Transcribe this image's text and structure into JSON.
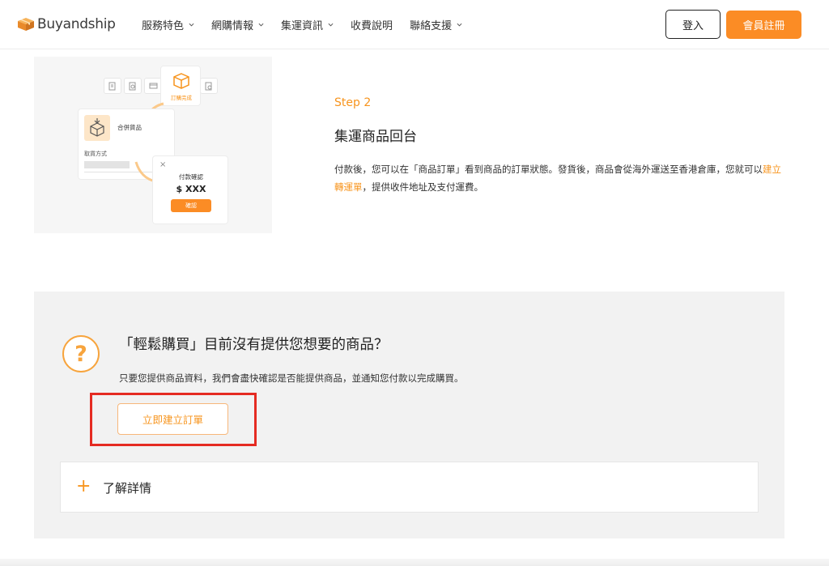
{
  "header": {
    "logo_text": "Buyandship",
    "nav": [
      {
        "label": "服務特色",
        "has_dropdown": true
      },
      {
        "label": "網購情報",
        "has_dropdown": true
      },
      {
        "label": "集運資訊",
        "has_dropdown": true
      },
      {
        "label": "收費說明",
        "has_dropdown": false
      },
      {
        "label": "聯絡支援",
        "has_dropdown": true
      }
    ],
    "login_label": "登入",
    "register_label": "會員註冊"
  },
  "illustration": {
    "order_complete": "訂購完成",
    "merge_goods": "合併貨品",
    "pickup_method": "取貨方式",
    "payment_confirm": "付款確認",
    "amount": "$ XXX",
    "confirm_button": "確認",
    "close_symbol": "×"
  },
  "step": {
    "label": "Step 2",
    "title": "集運商品回台",
    "desc_part1": "付款後，您可以在「商品訂單」看到商品的訂單狀態。發貨後，商品會從海外運送至香港倉庫，您就可以",
    "desc_link": "建立轉運單",
    "desc_part2": "，提供收件地址及支付運費。"
  },
  "panel": {
    "icon_symbol": "?",
    "title": "「輕鬆購買」目前沒有提供您想要的商品？",
    "desc": "只要您提供商品資料，我們會盡快確認是否能提供商品，並通知您付款以完成購買。",
    "create_button": "立即建立訂單",
    "accordion_symbol": "+",
    "accordion_label": "了解詳情"
  },
  "colors": {
    "brand_orange": "#fb8c25",
    "accent_orange": "#f7941d",
    "highlight_red": "#e52b22"
  }
}
